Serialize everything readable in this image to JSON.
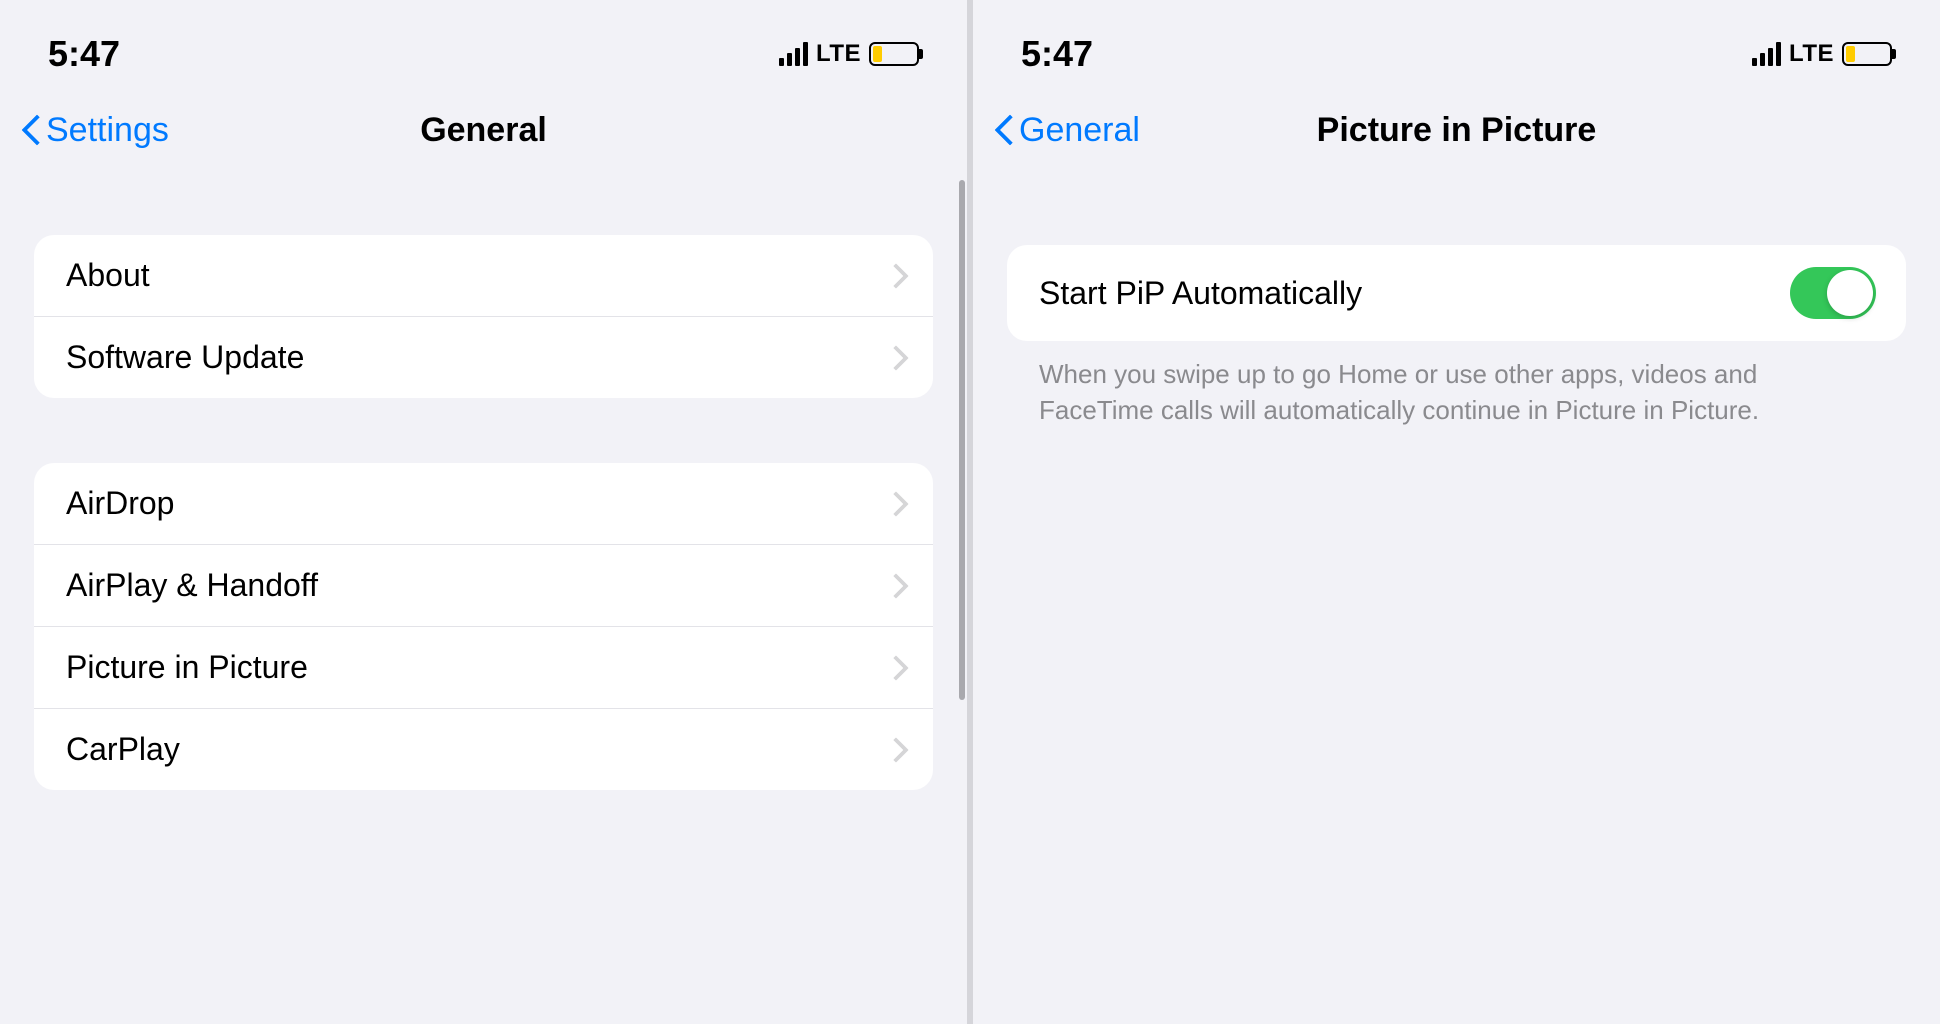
{
  "status": {
    "time": "5:47",
    "network": "LTE"
  },
  "left": {
    "back_label": "Settings",
    "title": "General",
    "group1": [
      {
        "label": "About"
      },
      {
        "label": "Software Update"
      }
    ],
    "group2": [
      {
        "label": "AirDrop"
      },
      {
        "label": "AirPlay & Handoff"
      },
      {
        "label": "Picture in Picture"
      },
      {
        "label": "CarPlay"
      }
    ]
  },
  "right": {
    "back_label": "General",
    "title": "Picture in Picture",
    "toggle_row": {
      "label": "Start PiP Automatically",
      "on": true
    },
    "footer": "When you swipe up to go Home or use other apps, videos and FaceTime calls will automatically continue in Picture in Picture."
  }
}
